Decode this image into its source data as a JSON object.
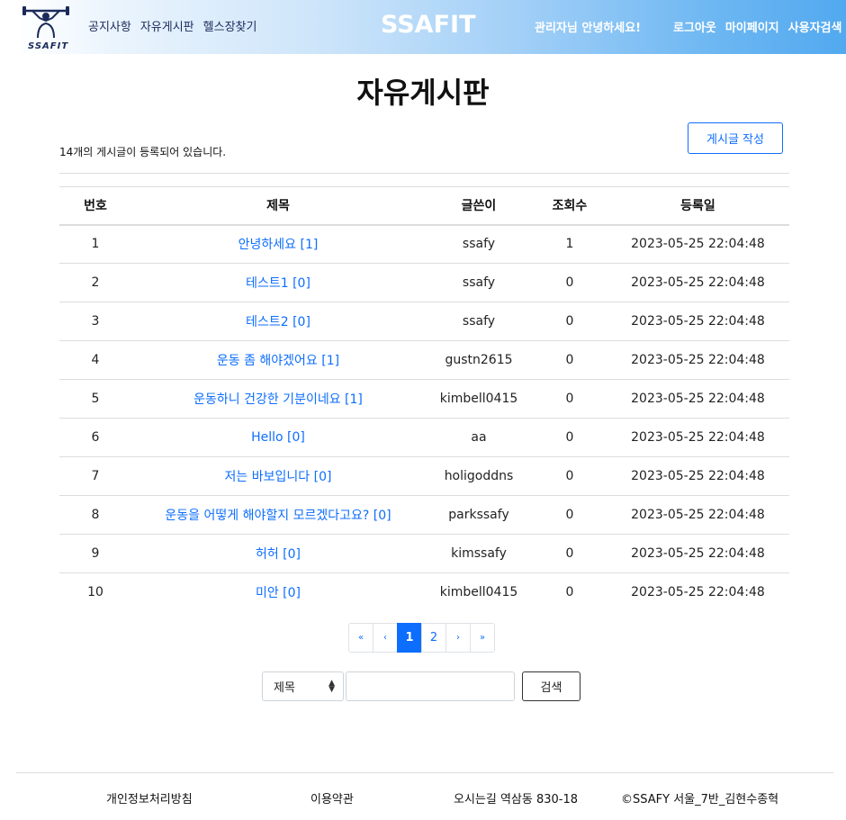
{
  "header": {
    "logo_text": "SSAFIT",
    "nav_left": [
      "공지사항",
      "자유게시판",
      "헬스장찾기"
    ],
    "brand": "SSAFIT",
    "greeting": "관리자님 안녕하세요!",
    "nav_right": [
      "로그아웃",
      "마이페이지",
      "사용자검색"
    ]
  },
  "page": {
    "title": "자유게시판",
    "count_text": "14개의 게시글이 등록되어 있습니다.",
    "write_button": "게시글 작성"
  },
  "table": {
    "columns": [
      "번호",
      "제목",
      "글쓴이",
      "조회수",
      "등록일"
    ],
    "rows": [
      {
        "no": "1",
        "title": "안녕하세요 [1]",
        "author": "ssafy",
        "views": "1",
        "date": "2023-05-25 22:04:48"
      },
      {
        "no": "2",
        "title": "테스트1 [0]",
        "author": "ssafy",
        "views": "0",
        "date": "2023-05-25 22:04:48"
      },
      {
        "no": "3",
        "title": "테스트2 [0]",
        "author": "ssafy",
        "views": "0",
        "date": "2023-05-25 22:04:48"
      },
      {
        "no": "4",
        "title": "운동 좀 해야겠어요 [1]",
        "author": "gustn2615",
        "views": "0",
        "date": "2023-05-25 22:04:48"
      },
      {
        "no": "5",
        "title": "운동하니 건강한 기분이네요 [1]",
        "author": "kimbell0415",
        "views": "0",
        "date": "2023-05-25 22:04:48"
      },
      {
        "no": "6",
        "title": "Hello [0]",
        "author": "aa",
        "views": "0",
        "date": "2023-05-25 22:04:48"
      },
      {
        "no": "7",
        "title": "저는 바보입니다 [0]",
        "author": "holigoddns",
        "views": "0",
        "date": "2023-05-25 22:04:48"
      },
      {
        "no": "8",
        "title": "운동을 어떻게 해야할지 모르겠다고요? [0]",
        "author": "parkssafy",
        "views": "0",
        "date": "2023-05-25 22:04:48"
      },
      {
        "no": "9",
        "title": "허허 [0]",
        "author": "kimssafy",
        "views": "0",
        "date": "2023-05-25 22:04:48"
      },
      {
        "no": "10",
        "title": "미안 [0]",
        "author": "kimbell0415",
        "views": "0",
        "date": "2023-05-25 22:04:48"
      }
    ]
  },
  "pagination": {
    "first": "«",
    "prev": "‹",
    "pages": [
      "1",
      "2"
    ],
    "current": "1",
    "next": "›",
    "last": "»"
  },
  "search": {
    "select_value": "제목",
    "input_value": "",
    "button": "검색"
  },
  "footer": {
    "privacy": "개인정보처리방침",
    "terms": "이용약관",
    "address": "오시는길 역삼동 830-18",
    "copyright": "©SSAFY 서울_7반_김현수종혁"
  },
  "colors": {
    "accent": "#0d6efd",
    "header_gradient_end": "#52a9ef"
  }
}
